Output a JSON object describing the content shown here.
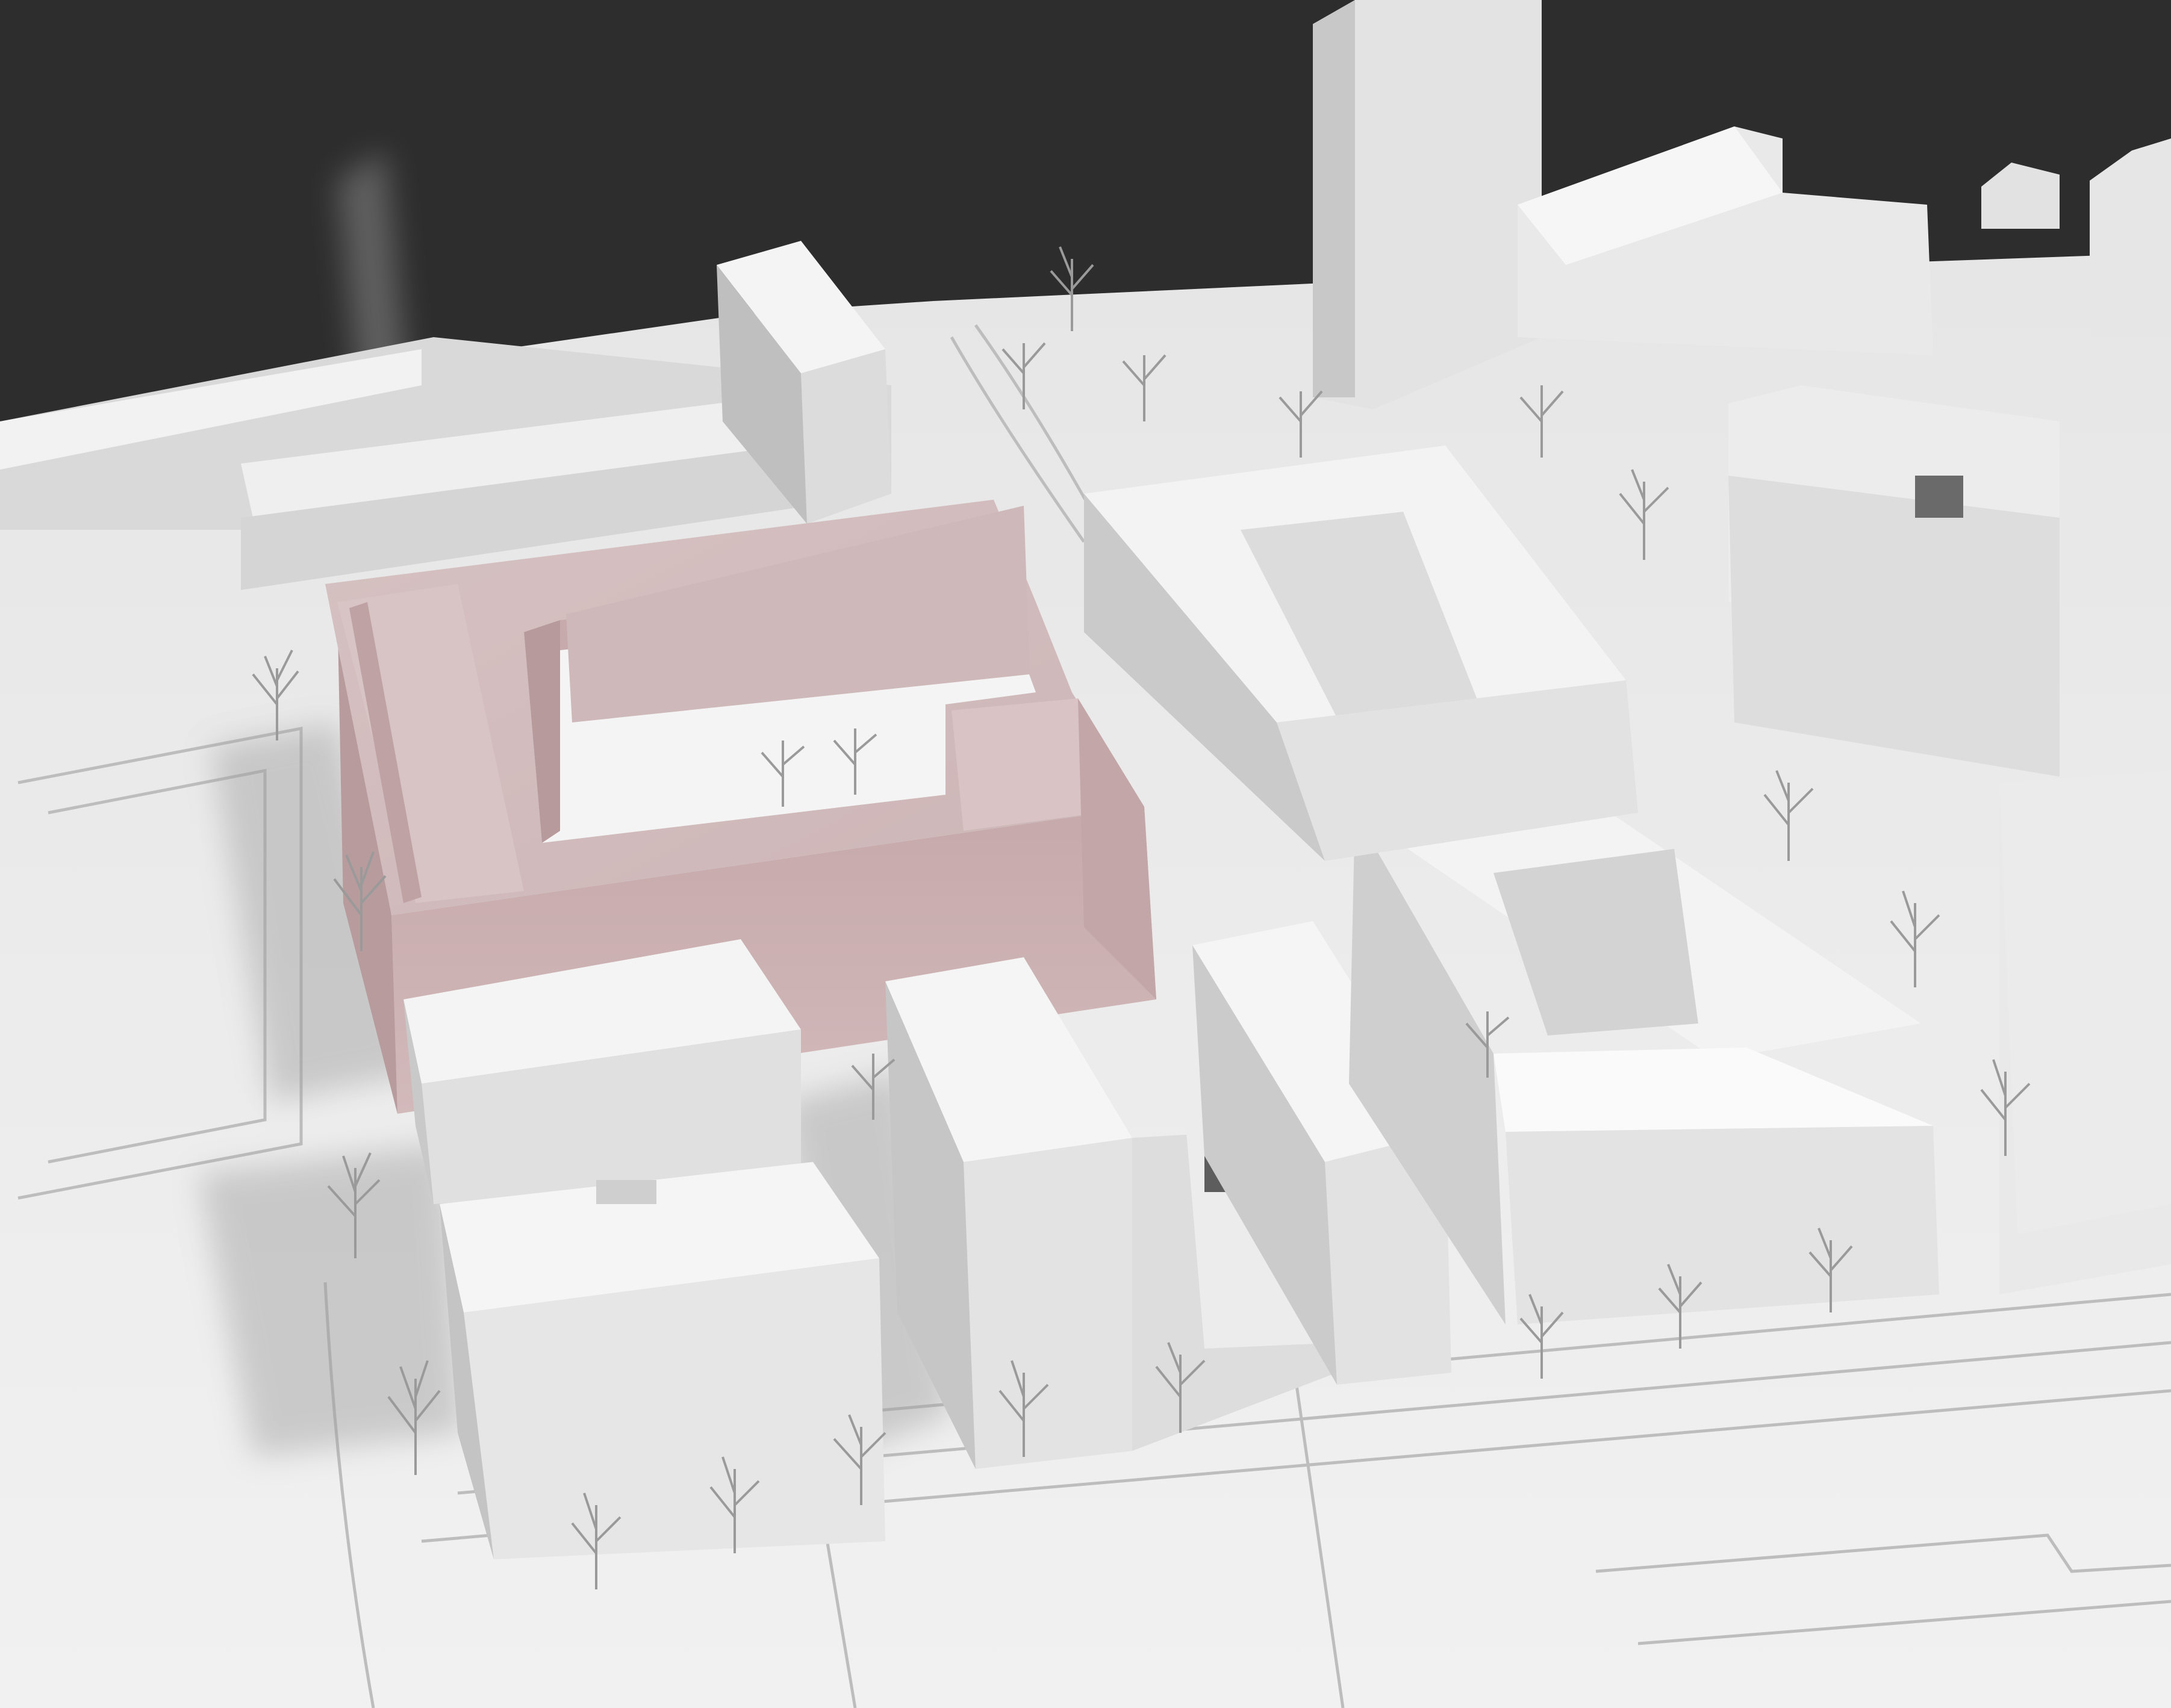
{
  "image": {
    "subject": "architectural-site-model",
    "highlighted_building_color": "#c9aeb0",
    "model_color": "#ebebeb",
    "background_color": "#2d2d2d"
  }
}
